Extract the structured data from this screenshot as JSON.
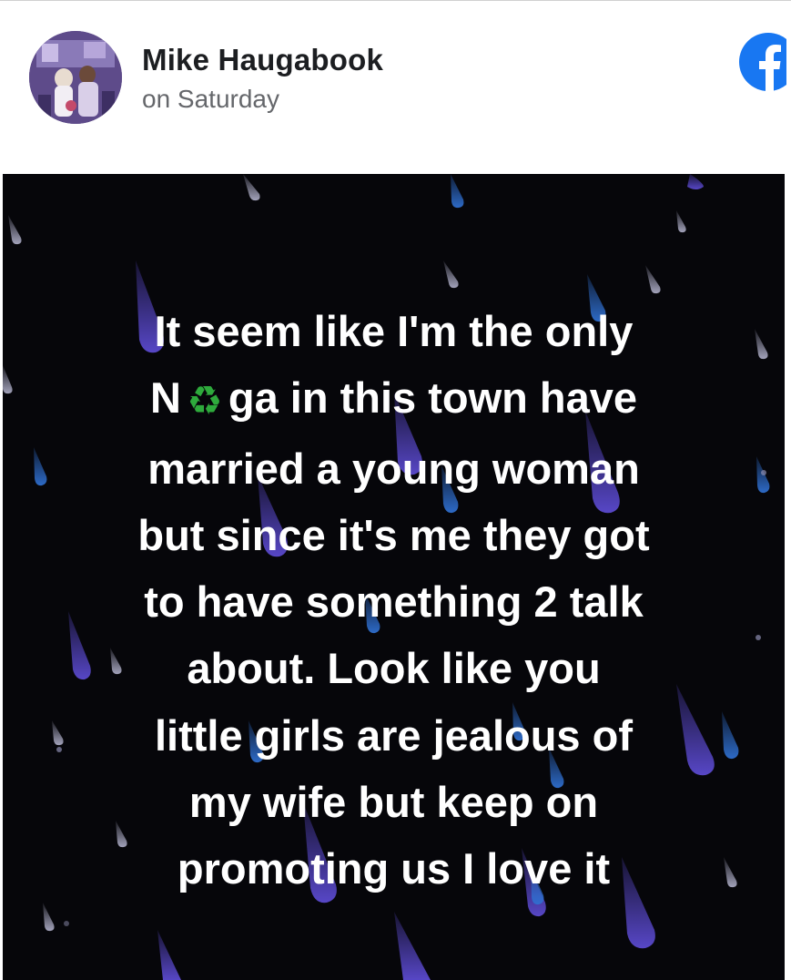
{
  "post": {
    "author": "Mike Haugabook",
    "time": "on Saturday",
    "platform_icon": "facebook-icon",
    "avatar": "profile-photo",
    "status_lines": [
      "It seem like I'm the only",
      "ga in this town have",
      "married a young woman",
      "but since it's me they got",
      "to have something 2 talk",
      "about. Look like you",
      "little girls are jealous of",
      "my wife but keep on",
      "promoting us I love it"
    ],
    "censor_prefix": "N",
    "censor_emoji": "♻",
    "censor_icon": "recycle-emoji-icon"
  },
  "colors": {
    "background_dark": "#06060a",
    "text": "#ffffff",
    "name": "#1c1e21",
    "meta": "#65676b",
    "facebook_blue": "#1877f2",
    "raindrop_purple": "#5b4ad0",
    "raindrop_blue": "#2f6fd0",
    "recycle_green": "#2eaa3c"
  }
}
